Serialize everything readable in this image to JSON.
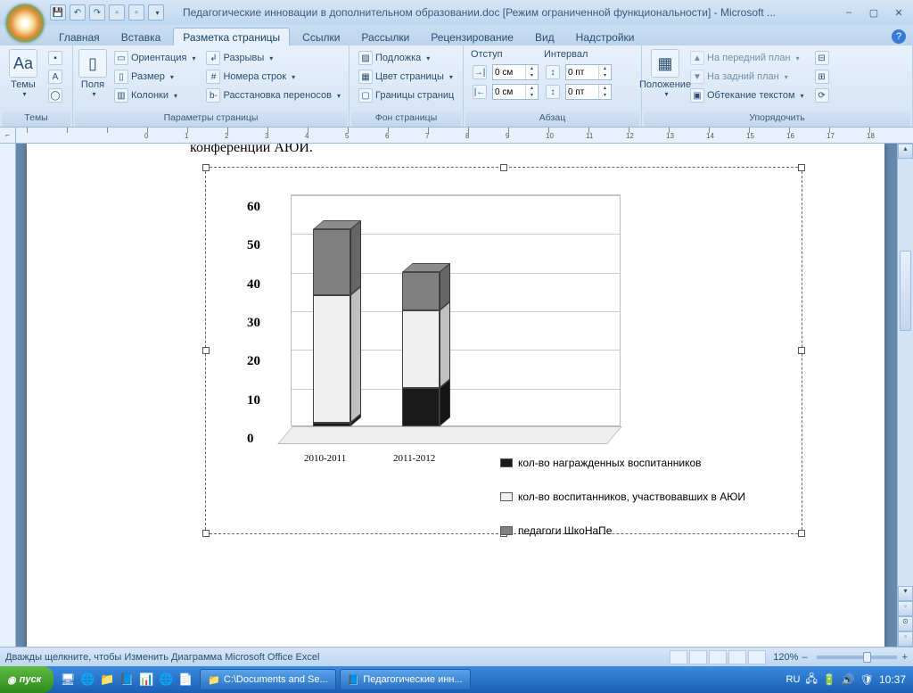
{
  "title": "Педагогические инновации в дополнительном образовании.doc [Режим ограниченной функциональности] - Microsoft ...",
  "tabs": [
    "Главная",
    "Вставка",
    "Разметка страницы",
    "Ссылки",
    "Рассылки",
    "Рецензирование",
    "Вид",
    "Надстройки"
  ],
  "active_tab": 2,
  "ribbon": {
    "themes": {
      "big": "Темы",
      "label": "Темы"
    },
    "page_setup": {
      "big": "Поля",
      "orient": "Ориентация",
      "size": "Размер",
      "cols": "Колонки",
      "breaks": "Разрывы",
      "lines": "Номера строк",
      "hyph": "Расстановка переносов",
      "label": "Параметры страницы"
    },
    "page_bg": {
      "wm": "Подложка",
      "color": "Цвет страницы",
      "borders": "Границы страниц",
      "label": "Фон страницы"
    },
    "para": {
      "indent": "Отступ",
      "spacing": "Интервал",
      "left": "0 см",
      "right": "0 см",
      "before": "0 пт",
      "after": "0 пт",
      "label": "Абзац"
    },
    "arrange": {
      "pos": "Положение",
      "front": "На передний план",
      "back": "На задний план",
      "wrap": "Обтекание текстом",
      "label": "Упорядочить"
    }
  },
  "ruler_start": -3,
  "ruler_end": 18,
  "page_cut_text": "конференции АЮИ.",
  "chart_data": {
    "type": "bar",
    "stacked": true,
    "view3d": true,
    "categories": [
      "2010-2011",
      "2011-2012"
    ],
    "series": [
      {
        "name": "кол-во награжденных воспитанников",
        "values": [
          1,
          10
        ],
        "color": "#1a1a1a"
      },
      {
        "name": "кол-во воспитанников, участвовавших в АЮИ",
        "values": [
          33,
          20
        ],
        "color": "#f0f0f0"
      },
      {
        "name": "педагоги ШкоНаПе",
        "values": [
          17,
          10
        ],
        "color": "#808080"
      }
    ],
    "ylim": [
      0,
      60
    ],
    "yticks": [
      0,
      10,
      20,
      30,
      40,
      50,
      60
    ],
    "xlabel": "",
    "ylabel": ""
  },
  "status": "Дважды щелкните, чтобы Изменить Диаграмма Microsoft Office Excel",
  "zoom": "120%",
  "taskbar": {
    "start": "пуск",
    "items": [
      "C:\\Documents and Se...",
      "Педагогические инн..."
    ],
    "lang": "RU",
    "time": "10:37"
  }
}
